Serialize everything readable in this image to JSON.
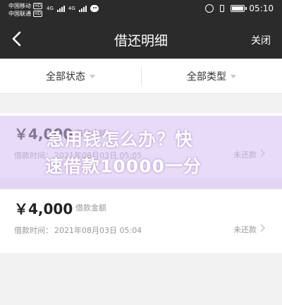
{
  "status_bar": {
    "carrier_1": "中国移动",
    "carrier_2": "中国联通",
    "net_badge": "HD",
    "net_1": "4G",
    "net_2": "4G",
    "time": "05:10"
  },
  "nav": {
    "title": "借还明细",
    "close_label": "关闭"
  },
  "filters": [
    {
      "label": "全部状态"
    },
    {
      "label": "全部类型"
    }
  ],
  "records": [
    {
      "amount": "￥4,000",
      "amount_label": "借款金额",
      "time_label": "借款时间：",
      "time_value": "2021年08月03日 05:05",
      "status": "未还款"
    },
    {
      "amount": "￥4,000",
      "amount_label": "借款金额",
      "time_label": "借款时间：",
      "time_value": "2021年08月03日 05:04",
      "status": "未还款"
    }
  ],
  "watermark": {
    "line1": "急用钱怎么办？快",
    "line2": "速借款10000一分"
  },
  "colors": {
    "bar_background": "#2b2b2b",
    "page_background": "#f2f2f2",
    "watermark_band": "#d6bef2"
  }
}
